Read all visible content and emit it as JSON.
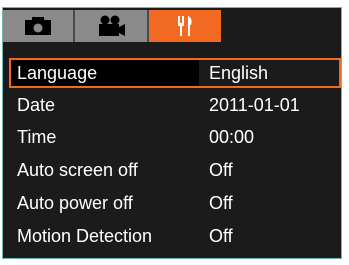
{
  "tabs": [
    {
      "id": "photo",
      "icon": "camera-icon",
      "active": false
    },
    {
      "id": "video",
      "icon": "video-camera-icon",
      "active": false
    },
    {
      "id": "setup",
      "icon": "settings-tools-icon",
      "active": true
    }
  ],
  "settings": [
    {
      "label": "Language",
      "value": "English",
      "selected": true
    },
    {
      "label": "Date",
      "value": "2011-01-01",
      "selected": false
    },
    {
      "label": "Time",
      "value": "00:00",
      "selected": false
    },
    {
      "label": "Auto screen off",
      "value": "Off",
      "selected": false
    },
    {
      "label": "Auto power off",
      "value": "Off",
      "selected": false
    },
    {
      "label": "Motion Detection",
      "value": "Off",
      "selected": false
    }
  ],
  "colors": {
    "accent": "#f26a21",
    "tab_inactive": "#8a8a8a",
    "background": "#1b1b1b",
    "frame": "#6fb6b6"
  }
}
